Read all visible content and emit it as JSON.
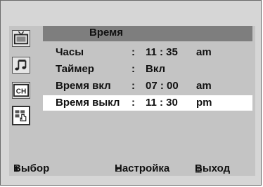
{
  "menu": {
    "title": "Время",
    "rows": [
      {
        "label": "Часы",
        "colon": ":",
        "value": "11 : 35",
        "ampm": "am"
      },
      {
        "label": "Таймер",
        "colon": ":",
        "value": "Вкл",
        "ampm": ""
      },
      {
        "label": "Время вкл",
        "colon": ":",
        "value": "07 : 00",
        "ampm": "am"
      },
      {
        "label": "Время выкл",
        "colon": ":",
        "value": "11 : 30",
        "ampm": "pm"
      }
    ],
    "selected_row": 3
  },
  "sidebar": {
    "icons": [
      "tv-icon",
      "music-note-icon",
      "channel-icon",
      "timer-setup-icon"
    ],
    "channel_icon_text": "CH",
    "selected_icon": 3
  },
  "bottom": {
    "select_glyph": "⬍",
    "select_label": "Выбор",
    "adjust_glyph": "±",
    "adjust_label": "Настройка",
    "exit_glyph": "▥",
    "exit_label": "Выход"
  },
  "colors": {
    "screen_bg": "#d6d6d6",
    "panel_bg": "#c4c4c4",
    "title_bar": "#7e7e7e",
    "highlight": "#ffffff"
  }
}
